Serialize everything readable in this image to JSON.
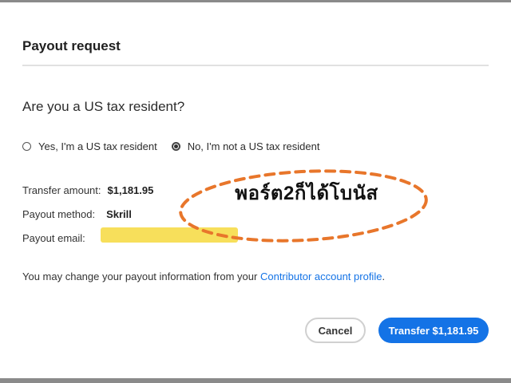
{
  "dialog": {
    "title": "Payout request",
    "question": "Are you a US tax resident?",
    "radio_options": [
      {
        "label": "Yes, I'm a US tax resident",
        "checked": false
      },
      {
        "label": "No, I'm not a US tax resident",
        "checked": true
      }
    ],
    "transfer_amount_label": "Transfer amount:",
    "transfer_amount_value": "$1,181.95",
    "payout_method_label": "Payout method:",
    "payout_method_value": "Skrill",
    "payout_email_label": "Payout email:",
    "note_text": "You may change your payout information from your ",
    "note_link": "Contributor account profile",
    "note_end": ".",
    "cancel_label": "Cancel",
    "transfer_label": "Transfer $1,181.95"
  },
  "overlay": {
    "handwritten_text": "พอร์ต2ก็ได้โบนัส",
    "ellipse_color": "#e8762b",
    "highlight_color": "#f7dd52"
  },
  "colors": {
    "accent": "#1473e6"
  }
}
